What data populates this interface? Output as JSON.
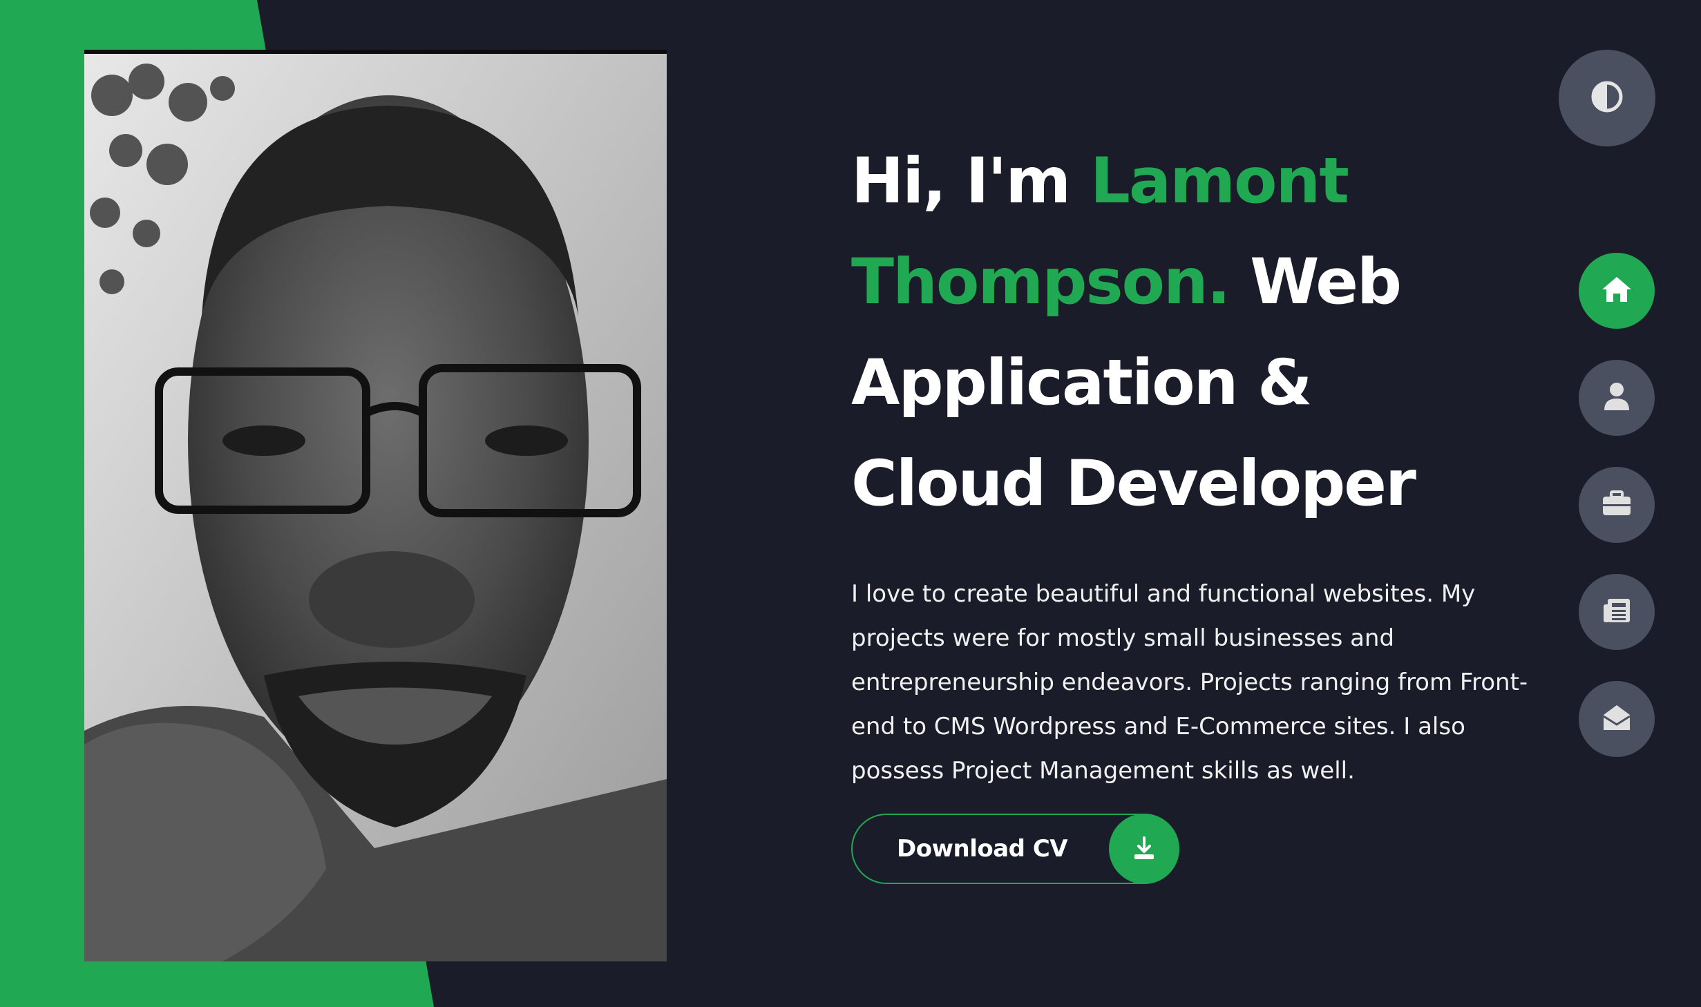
{
  "hero": {
    "greeting": "Hi, I'm ",
    "name_line1": "Lamont",
    "name_line2": "Thompson.",
    "role_line1": "Web",
    "role_line2": "Application &",
    "role_line3": "Cloud Developer",
    "intro": "I love to create beautiful and functional websites. My projects were for mostly small businesses and entrepreneurship endeavors. Projects ranging from Front-end to CMS Wordpress and E-Commerce sites. I also possess Project Management skills as well."
  },
  "cv_button": {
    "label": "Download CV",
    "icon": "download-icon"
  },
  "theme_toggle": {
    "icon": "contrast-icon"
  },
  "nav": {
    "items": [
      {
        "icon": "home-icon",
        "active": true
      },
      {
        "icon": "user-icon",
        "active": false
      },
      {
        "icon": "briefcase-icon",
        "active": false
      },
      {
        "icon": "newspaper-icon",
        "active": false
      },
      {
        "icon": "envelope-open-icon",
        "active": false
      }
    ]
  },
  "colors": {
    "background": "#1a1d29",
    "accent": "#20a853",
    "nav_button": "#4b5060",
    "text": "#ffffff"
  }
}
